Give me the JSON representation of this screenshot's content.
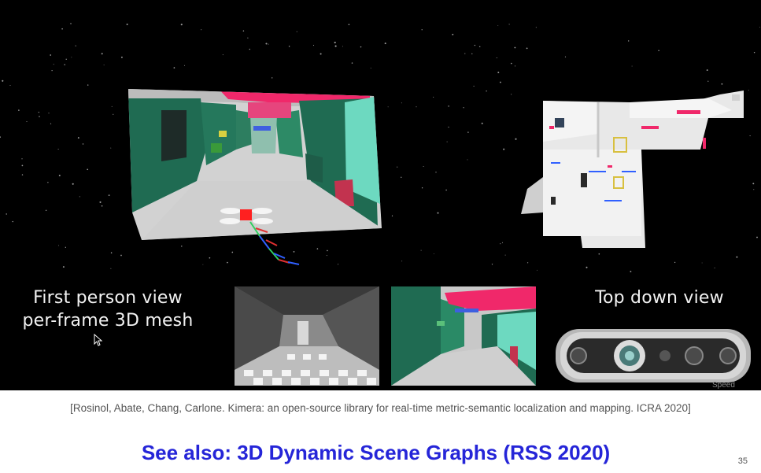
{
  "video": {
    "first_person_label": "First person view\nper-frame 3D mesh",
    "top_down_label": "Top down view",
    "corner_text": "Speed"
  },
  "citation": "[Rosinol, Abate, Chang, Carlone. Kimera: an open-source library for real-time metric-semantic localization and mapping. ICRA 2020]",
  "see_also": "See also: 3D Dynamic Scene Graphs (RSS 2020)",
  "page_number": "35",
  "colors": {
    "mesh_green": "#1f6b52",
    "mesh_teal": "#6dd9c0",
    "mesh_pink": "#f0286a",
    "floor_gray": "#d2d2d2",
    "link_blue": "#2525d8"
  }
}
